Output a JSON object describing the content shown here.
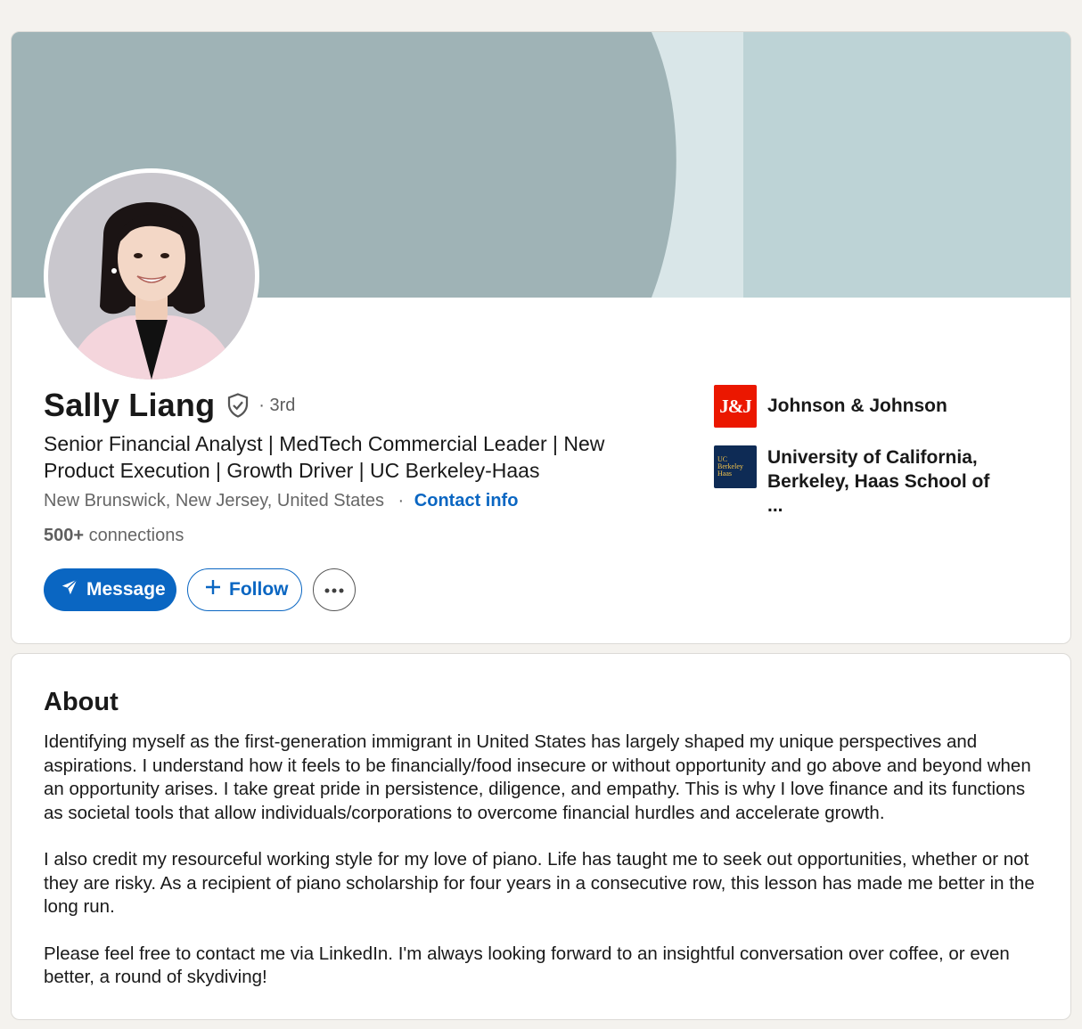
{
  "profile": {
    "name": "Sally Liang",
    "degree": "· 3rd",
    "headline": "Senior Financial Analyst | MedTech Commercial Leader | New Product Execution | Growth Driver | UC Berkeley-Haas",
    "location": "New Brunswick, New Jersey, United States",
    "contact_separator": "·",
    "contact_label": "Contact info",
    "connections_count": "500+",
    "connections_label": "connections",
    "verified_icon": "shield-check-icon"
  },
  "actions": {
    "message_label": "Message",
    "follow_label": "Follow",
    "more_icon": "ellipsis-icon"
  },
  "orgs": [
    {
      "logo_text": "J&J",
      "name": "Johnson & Johnson"
    },
    {
      "logo_text": "UC Berkeley Haas",
      "name": "University of California, Berkeley, Haas School of ..."
    }
  ],
  "about": {
    "title": "About",
    "paragraphs": [
      "Identifying myself as the first-generation immigrant in United States has largely shaped my unique perspectives and aspirations. I understand how it feels to be financially/food insecure or without opportunity and go above and beyond when an opportunity arises. I take great pride in persistence, diligence, and empathy. This is why I love finance and its functions as societal tools that allow individuals/corporations to overcome financial hurdles and accelerate growth.",
      "I also credit my resourceful working style for my love of piano. Life has taught me to seek out opportunities, whether or not they are risky. As a recipient of piano scholarship for four years in a consecutive row, this lesson has made me better in the long run.",
      "Please feel free to contact me via LinkedIn. I'm always looking forward to an insightful conversation over coffee, or even better, a round of skydiving!"
    ]
  },
  "colors": {
    "accent": "#0a66c2",
    "banner_dark": "#9fb3b6",
    "banner_light": "#bdd3d6",
    "banner_band": "#d9e6e8",
    "jj_red": "#eb1700",
    "berkeley_navy": "#0e2b55"
  }
}
